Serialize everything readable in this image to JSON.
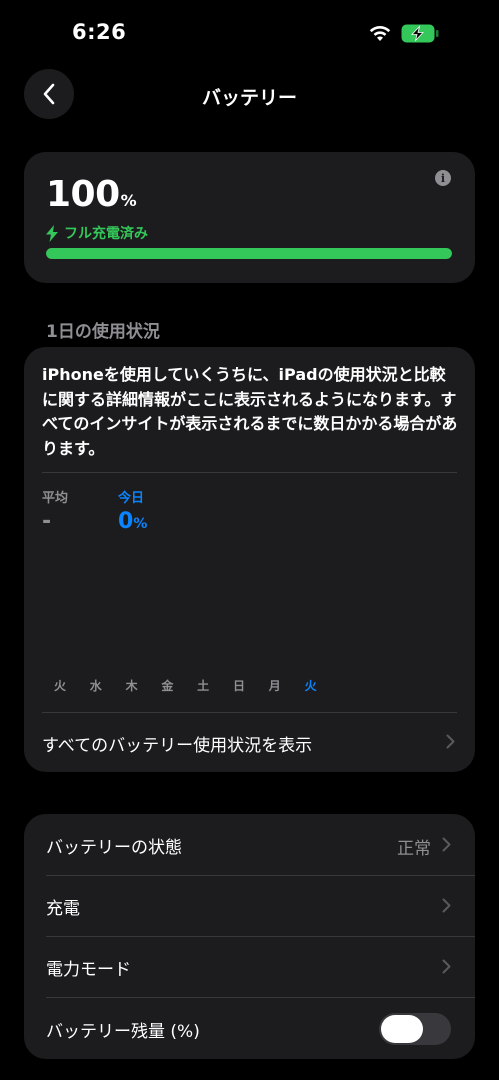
{
  "status": {
    "time": "6:26"
  },
  "nav": {
    "title": "バッテリー"
  },
  "battery": {
    "percent": "100",
    "unit": "%",
    "status": "フル充電済み",
    "level": 1.0,
    "info_icon_glyph": "i"
  },
  "usage": {
    "section_header": "1日の使用状況",
    "message": "iPhoneを使用していくうちに、iPadの使用状況と比較に関する詳細情報がここに表示されるようになります。すべてのインサイトが表示されるまでに数日かかる場合があります。",
    "average_label": "平均",
    "average_value": "-",
    "today_label": "今日",
    "today_value": "0",
    "today_unit": "%",
    "days": [
      "火",
      "水",
      "木",
      "金",
      "土",
      "日",
      "月",
      "火"
    ],
    "active_day_index": 7,
    "show_all_label": "すべてのバッテリー使用状況を表示"
  },
  "settings": {
    "health_label": "バッテリーの状態",
    "health_value": "正常",
    "charging_label": "充電",
    "power_mode_label": "電力モード",
    "percentage_label": "バッテリー残量 (%)",
    "percentage_enabled": false
  },
  "colors": {
    "accent_green": "#34c759",
    "accent_blue": "#0a84ff",
    "card_bg": "#1c1c1e"
  }
}
